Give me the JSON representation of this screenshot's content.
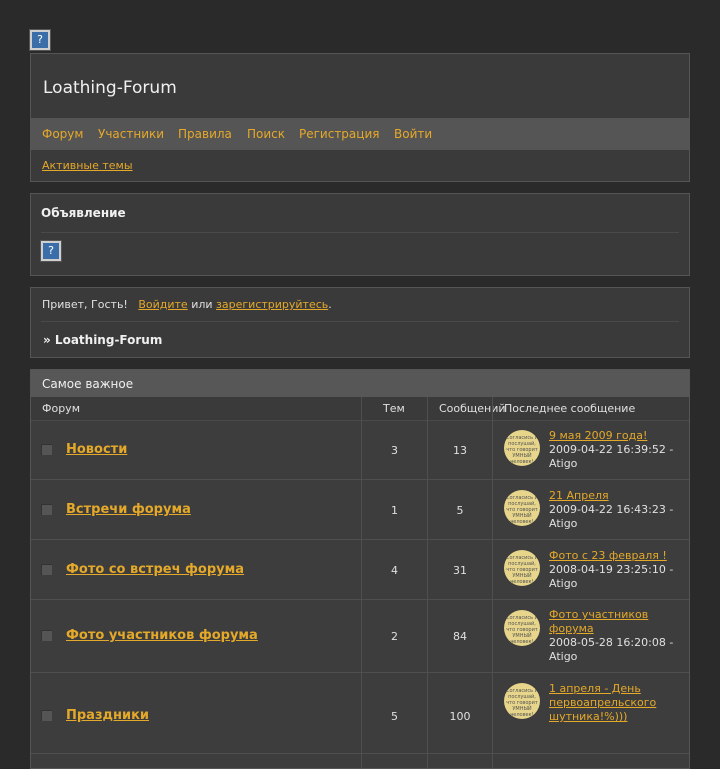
{
  "app": {
    "top_icon": "question-icon"
  },
  "header": {
    "title": "Loathing-Forum",
    "nav": [
      "Форум",
      "Участники",
      "Правила",
      "Поиск",
      "Регистрация",
      "Войти"
    ],
    "active_topics": "Активные темы"
  },
  "announcement": {
    "title": "Объявление",
    "icon": "question-icon"
  },
  "greeting": {
    "prefix": "Привет, Гость!",
    "login": "Войдите",
    "or": "или",
    "register": "зарегистрируйтесь",
    "period": ".",
    "crumb": "» Loathing-Forum"
  },
  "forum": {
    "section_title": "Самое важное",
    "columns": {
      "forum": "Форум",
      "topics": "Тем",
      "posts": "Сообщений",
      "last": "Последнее сообщение"
    },
    "avatar_text": "Согласись и послушай, что говорит УМНЫЙ человек!",
    "rows": [
      {
        "name": "Новости",
        "topics": "3",
        "posts": "13",
        "last_title": "9 мая 2009 года!",
        "last_date": "2009-04-22 16:39:52 -",
        "last_author": "Atigo"
      },
      {
        "name": "Встречи форума",
        "topics": "1",
        "posts": "5",
        "last_title": "21 Апреля",
        "last_date": "2009-04-22 16:43:23 -",
        "last_author": "Atigo"
      },
      {
        "name": "Фото со встреч форума",
        "topics": "4",
        "posts": "31",
        "last_title": "Фото с 23 февраля !",
        "last_date": "2008-04-19 23:25:10 -",
        "last_author": "Atigo"
      },
      {
        "name": "Фото участников форума",
        "topics": "2",
        "posts": "84",
        "last_title": "Фото участников форума",
        "last_date": "2008-05-28 16:20:08 -",
        "last_author": "Atigo"
      },
      {
        "name": "Праздники",
        "topics": "5",
        "posts": "100",
        "last_title": "1 апреля - День первоапрельского шутника!%)))",
        "last_date": "",
        "last_author": ""
      }
    ]
  }
}
